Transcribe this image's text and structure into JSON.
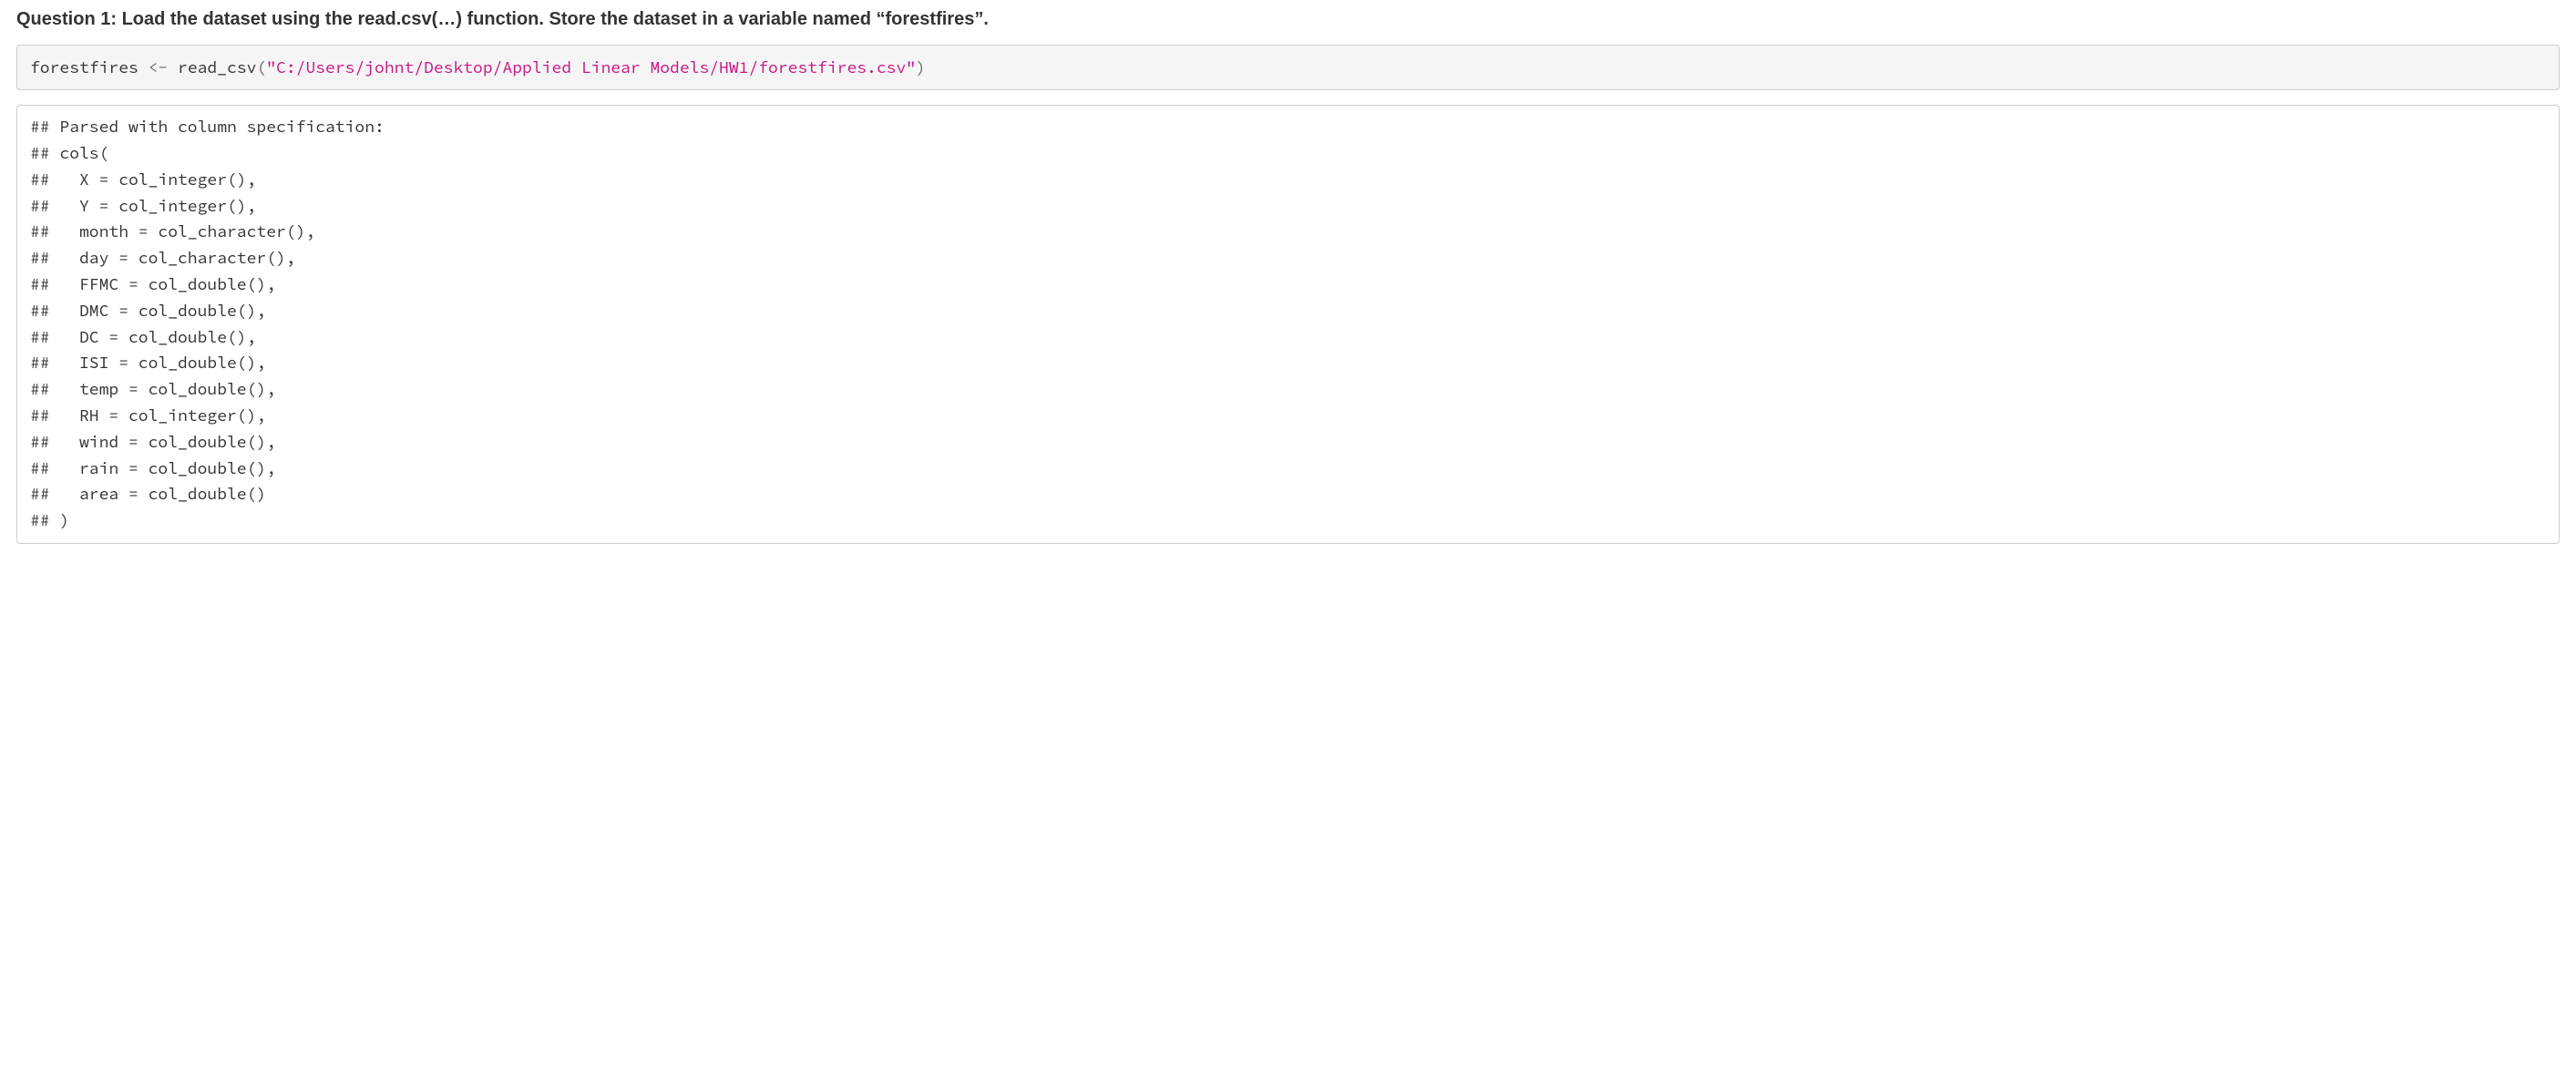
{
  "heading": "Question 1: Load the dataset using the read.csv(…) function. Store the dataset in a variable named “forestfires”.",
  "code_input": {
    "tokens": {
      "var": "forestfires ",
      "assign": "<-",
      "space": " ",
      "func": "read_csv",
      "lparen": "(",
      "string": "\"C:/Users/johnt/Desktop/Applied Linear Models/HW1/forestfires.csv\"",
      "rparen": ")"
    }
  },
  "code_output_lines": [
    "## Parsed with column specification:",
    "## cols(",
    "##   X = col_integer(),",
    "##   Y = col_integer(),",
    "##   month = col_character(),",
    "##   day = col_character(),",
    "##   FFMC = col_double(),",
    "##   DMC = col_double(),",
    "##   DC = col_double(),",
    "##   ISI = col_double(),",
    "##   temp = col_double(),",
    "##   RH = col_integer(),",
    "##   wind = col_double(),",
    "##   rain = col_double(),",
    "##   area = col_double()",
    "## )"
  ]
}
